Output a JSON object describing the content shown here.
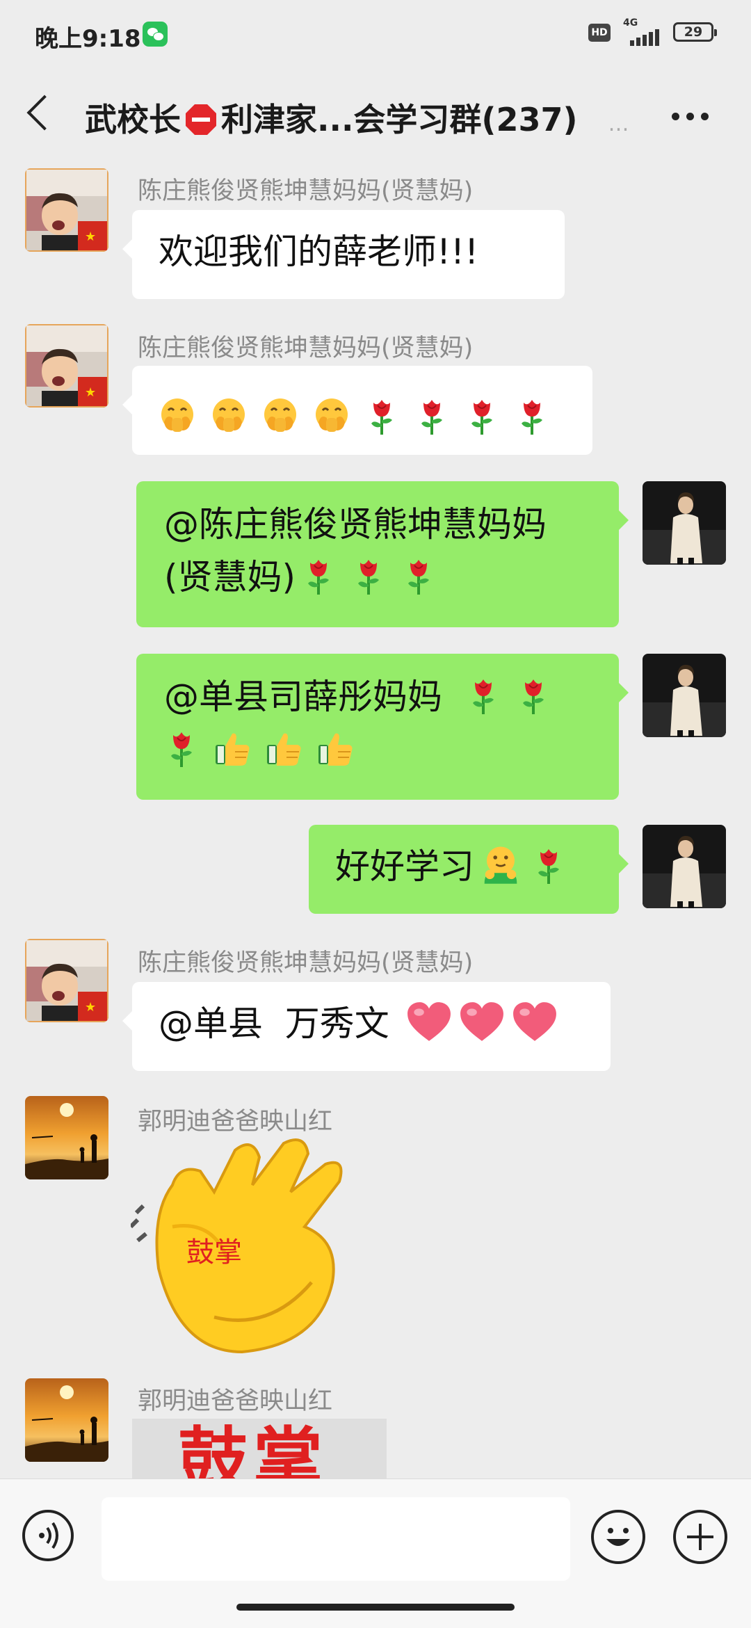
{
  "status_bar": {
    "time": "晚上9:18",
    "hd": "HD",
    "network": "4G",
    "battery": "29"
  },
  "header": {
    "title": "武校长",
    "title_rest": "利津家...会学习群(237)",
    "title_overflow": "…"
  },
  "messages": [
    {
      "sender": "陈庄熊俊贤熊坤慧妈妈(贤慧妈)",
      "text": "欢迎我们的薛老师!!!"
    },
    {
      "sender": "陈庄熊俊贤熊坤慧妈妈(贤慧妈)",
      "emojis": [
        "hand-over-mouth-emoji",
        "hand-over-mouth-emoji",
        "hand-over-mouth-emoji",
        "hand-over-mouth-emoji",
        "rose-emoji",
        "rose-emoji",
        "rose-emoji",
        "rose-emoji"
      ]
    },
    {
      "line1": "@陈庄熊俊贤熊坤慧妈妈",
      "line2": "(贤慧妈)",
      "emojis": [
        "rose-emoji",
        "rose-emoji",
        "rose-emoji"
      ]
    },
    {
      "line1": "@单县司薛彤妈妈",
      "emojis_line1": [
        "rose-emoji",
        "rose-emoji"
      ],
      "emojis_line2": [
        "rose-emoji",
        "thumbs-up-emoji",
        "thumbs-up-emoji",
        "thumbs-up-emoji"
      ]
    },
    {
      "text": "好好学习",
      "emojis": [
        "hugging-face-emoji",
        "rose-emoji"
      ]
    },
    {
      "sender": "陈庄熊俊贤熊坤慧妈妈(贤慧妈)",
      "text": "@单县  万秀文",
      "emojis": [
        "heart-emoji",
        "heart-emoji",
        "heart-emoji"
      ]
    },
    {
      "sender": "郭明迪爸爸映山红",
      "sticker_text": "鼓掌"
    },
    {
      "sender": "郭明迪爸爸映山红",
      "sticker_text": "鼓掌"
    }
  ],
  "colors": {
    "background": "#ededed",
    "incoming_bubble": "#ffffff",
    "outgoing_bubble": "#95ec69",
    "sender_name": "#8a8a8a",
    "sticker_red": "#e02020"
  },
  "icons": {
    "back": "back-arrow-icon",
    "more": "more-icon",
    "voice": "voice-icon",
    "emoji": "emoji-icon",
    "plus": "plus-icon"
  }
}
